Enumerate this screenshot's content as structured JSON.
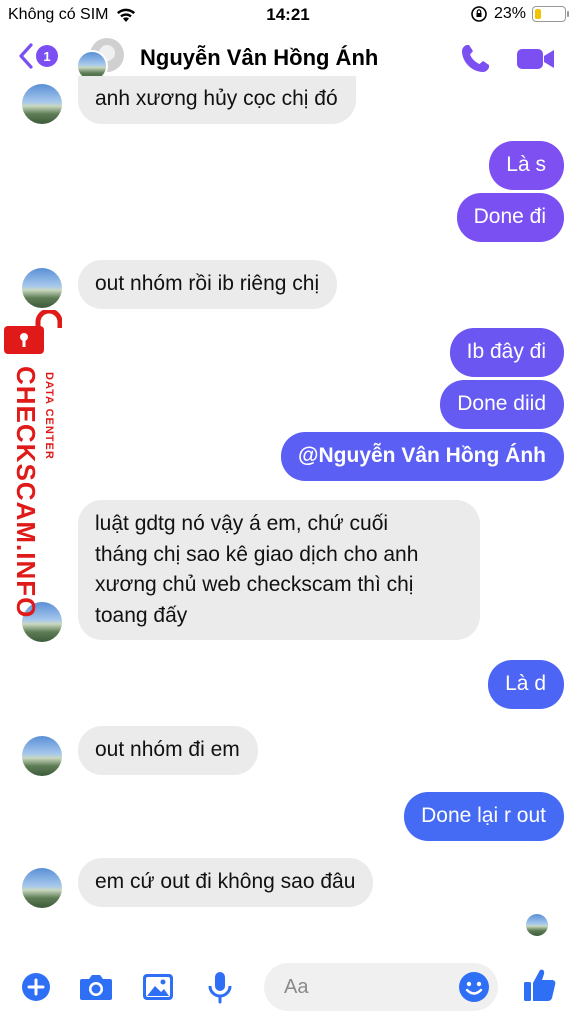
{
  "status_bar": {
    "carrier": "Không có SIM",
    "time": "14:21",
    "battery_percent_label": "23%",
    "battery_level": 0.23
  },
  "header": {
    "back_badge": "1",
    "contact_name": "Nguyễn Vân Hồng Ánh",
    "accent_color": "#7b4ff2"
  },
  "watermark": {
    "main": "CHECKSCAM.INFO",
    "sub": "DATA CENTER",
    "color": "#e01919"
  },
  "messages": [
    {
      "side": "in",
      "text": "anh xương hủy cọc chị đó"
    },
    {
      "side": "out",
      "text": "Là s"
    },
    {
      "side": "out",
      "text": "Done đi"
    },
    {
      "side": "in",
      "text": "out nhóm rồi ib riêng chị"
    },
    {
      "side": "out",
      "text": "Ib đây đi"
    },
    {
      "side": "out",
      "text": "Done diid"
    },
    {
      "side": "out",
      "text": "@Nguyễn Vân Hồng Ánh"
    },
    {
      "side": "in",
      "lines": [
        "luật gdtg nó vậy á em, chứ cuối",
        "tháng chị sao kê giao dịch cho anh",
        "xương chủ web checkscam thì chị",
        "toang đấy"
      ]
    },
    {
      "side": "out",
      "text": "Là d"
    },
    {
      "side": "in",
      "text": "out nhóm đi em"
    },
    {
      "side": "out",
      "text": "Done lại r out"
    },
    {
      "side": "in",
      "text": "em cứ out đi không sao đâu"
    }
  ],
  "composer": {
    "placeholder": "Aa"
  },
  "icons": [
    "back-chevron-icon",
    "phone-icon",
    "video-camera-icon",
    "plus-icon",
    "camera-icon",
    "image-icon",
    "microphone-icon",
    "emoji-icon",
    "thumbs-up-icon",
    "wifi-icon",
    "orientation-lock-icon",
    "lock-icon"
  ]
}
